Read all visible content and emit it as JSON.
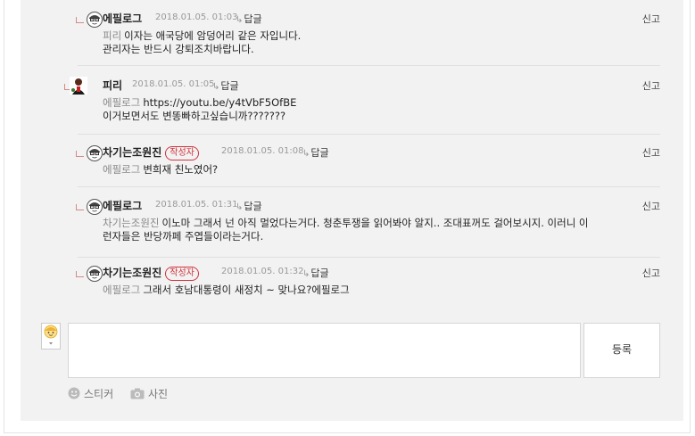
{
  "comments": [
    {
      "author": "에필로그",
      "badge": "",
      "date": "2018.01.05. 01:03",
      "reply_label": "답글",
      "report_label": "신고",
      "mention": "피리",
      "lines": [
        "이자는 애국당에 암덩어리 같은 자입니다.",
        "관리자는 반드시 강퇴조치바랍니다."
      ]
    },
    {
      "author": "피리",
      "badge": "",
      "date": "2018.01.05. 01:05",
      "reply_label": "답글",
      "report_label": "신고",
      "mention": "에필로그",
      "lines": [
        "https://youtu.be/y4tVbF5OfBE",
        "이거보면서도 변똥빠하고싶습니까???????"
      ]
    },
    {
      "author": "차기는조원진",
      "badge": "작성자",
      "date": "2018.01.05. 01:08",
      "reply_label": "답글",
      "report_label": "신고",
      "mention": "에필로그",
      "lines": [
        "변희재 친노였어?"
      ]
    },
    {
      "author": "에필로그",
      "badge": "",
      "date": "2018.01.05. 01:31",
      "reply_label": "답글",
      "report_label": "신고",
      "mention": "차기는조원진",
      "lines": [
        "이노마 그래서 넌 아직 멀었다는거다. 청춘투쟁을 읽어봐야 알지.. 조대표꺼도 걸어보시지. 이러니 이",
        "런자들은 반당까페 주엽들이라는거다."
      ]
    },
    {
      "author": "차기는조원진",
      "badge": "작성자",
      "date": "2018.01.05. 01:32",
      "reply_label": "답글",
      "report_label": "신고",
      "mention": "에필로그",
      "lines": [
        "그래서 호남대통령이 새정치 ~ 맞나요?에필로그"
      ]
    }
  ],
  "write": {
    "submit_label": "등록",
    "sticker_label": "스티커",
    "photo_label": "사진"
  },
  "colors": {
    "badge": "#d0343d",
    "panel_bg": "#f2f2f2"
  }
}
